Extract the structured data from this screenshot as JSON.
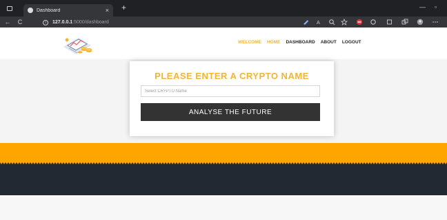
{
  "browser": {
    "tab_title": "Dashboard",
    "tab_close": "×",
    "new_tab": "+",
    "url_host": "127.0.0.1",
    "url_path": ":5000/dashboard",
    "minimize": "—",
    "restore": "▫",
    "back": "←",
    "reload": "C",
    "info": "i"
  },
  "header": {
    "nav": [
      {
        "label": "WELCOME",
        "color": "#f3b433"
      },
      {
        "label": "HOME",
        "color": "#f3b433"
      },
      {
        "label": "DASHBOARD",
        "color": "#222222"
      },
      {
        "label": "ABOUT",
        "color": "#222222"
      },
      {
        "label": "LOGOUT",
        "color": "#222222"
      }
    ]
  },
  "card": {
    "title": "PLEASE ENTER A CRYPTO NAME",
    "input_placeholder": "Select CRYPTO Name",
    "input_value": "",
    "button_label": "ANALYSE THE FUTURE"
  },
  "colors": {
    "accent": "#f3b433",
    "orange_band": "#ffa500",
    "dark_band": "#212a33",
    "button": "#333333"
  },
  "icons": [
    "window-icon",
    "tab-favicon-icon",
    "back-icon",
    "reload-icon",
    "info-icon",
    "extension-icon",
    "read-aloud-icon",
    "zoom-icon",
    "favorites-icon",
    "collections-icon",
    "profile-icon",
    "more-icon",
    "logo-icon"
  ]
}
